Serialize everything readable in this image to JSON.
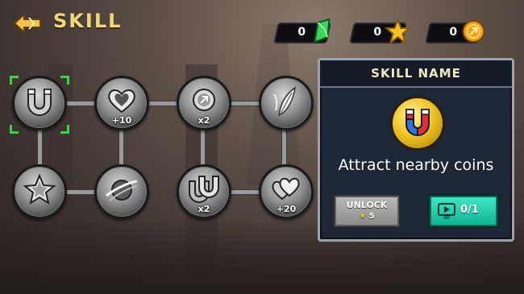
{
  "header": {
    "title": "SKILL",
    "back_icon": "back-arrow-icon"
  },
  "resources": [
    {
      "name": "gems",
      "value": "0",
      "icon": "green-crystal-icon"
    },
    {
      "name": "stars",
      "value": "0",
      "icon": "gold-star-icon"
    },
    {
      "name": "coins",
      "value": "0",
      "icon": "gold-coin-icon"
    }
  ],
  "skill_tree": {
    "nodes": [
      {
        "id": "magnet-1",
        "icon": "magnet-icon",
        "badge": "",
        "selected": true
      },
      {
        "id": "heart-1",
        "icon": "heart-icon",
        "badge": "+10"
      },
      {
        "id": "coin-1",
        "icon": "coin-icon",
        "badge": "x2"
      },
      {
        "id": "feather-1",
        "icon": "feather-icon",
        "badge": ""
      },
      {
        "id": "star-1",
        "icon": "star-icon",
        "badge": ""
      },
      {
        "id": "planet-1",
        "icon": "planet-icon",
        "badge": ""
      },
      {
        "id": "magnet-2",
        "icon": "magnet-icon",
        "badge": "x2"
      },
      {
        "id": "heart-2",
        "icon": "hearts-icon",
        "badge": "+20"
      }
    ]
  },
  "panel": {
    "heading": "SKILL NAME",
    "icon": "magnet-icon",
    "description": "Attract nearby coins",
    "unlock_button": {
      "label": "UNLOCK",
      "cost": "5",
      "cost_icon": "star-icon"
    },
    "ad_button": {
      "icon": "video-ad-icon",
      "ad_label": "AD",
      "progress": "0/1"
    }
  },
  "colors": {
    "title": "#f3d67a",
    "panel_bg": "#1e2735",
    "ad_button": "#1fcca8",
    "selection": "#39d24a"
  }
}
